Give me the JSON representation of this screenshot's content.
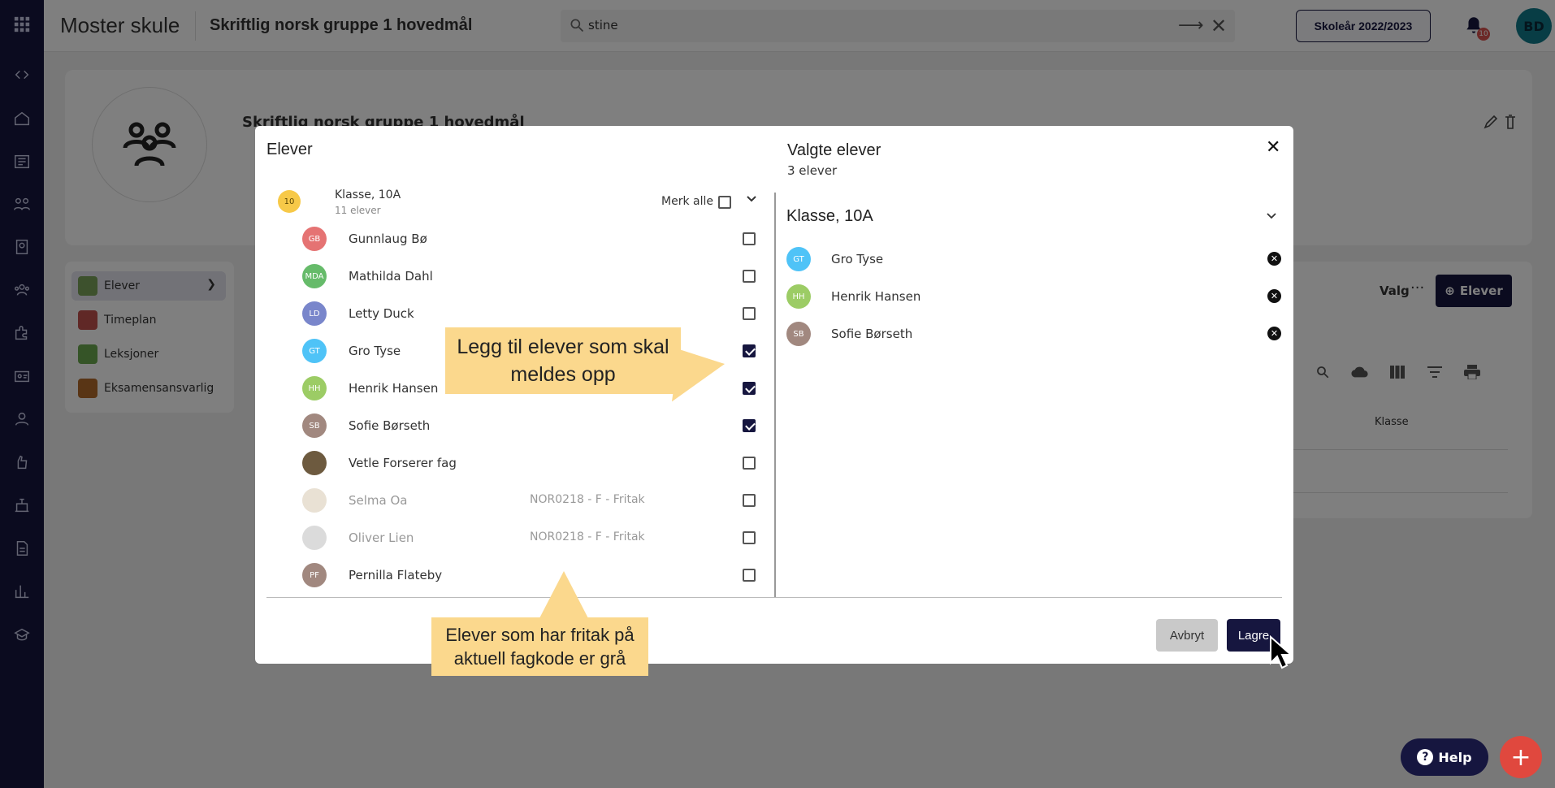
{
  "topbar": {
    "app_title": "Moster skule",
    "page_title": "Skriftlig norsk gruppe 1 hovedmål",
    "search_value": "stine",
    "school_year_button": "Skoleår 2022/2023",
    "notification_count": "10",
    "user_initials": "BD"
  },
  "rail_icons": [
    "apps-icon",
    "code-icon",
    "home-icon",
    "newspaper-icon",
    "groups-icon",
    "badge-icon",
    "people-icon",
    "puzzle-icon",
    "id-card-icon",
    "person-icon",
    "hand-icon",
    "building-icon",
    "document-icon",
    "bar-chart-icon",
    "school-icon"
  ],
  "background": {
    "card_title": "Skriftlig norsk gruppe 1 hovedmål",
    "side_menu": [
      {
        "label": "Elever",
        "icon": "students-icon"
      },
      {
        "label": "Timeplan",
        "icon": "clock-icon"
      },
      {
        "label": "Leksjoner",
        "icon": "grid-icon"
      },
      {
        "label": "Eksamensansvarlig",
        "icon": "teacher-icon"
      }
    ],
    "valg_label": "Valg",
    "elever_button": "Elever",
    "klasse_column": "Klasse"
  },
  "modal": {
    "title": "Elever",
    "class_group": {
      "avatar": "10",
      "name": "Klasse, 10A",
      "count": "11 elever"
    },
    "select_all_label": "Merk alle",
    "students": [
      {
        "initials": "GB",
        "name": "Gunnlaug Bø",
        "color": "#e57373",
        "checked": false,
        "exemption": "",
        "grey": false
      },
      {
        "initials": "MDA",
        "name": "Mathilda Dahl",
        "color": "#66bb6a",
        "checked": false,
        "exemption": "",
        "grey": false
      },
      {
        "initials": "LD",
        "name": "Letty Duck",
        "color": "#7986cb",
        "checked": false,
        "exemption": "",
        "grey": false
      },
      {
        "initials": "GT",
        "name": "Gro Tyse",
        "color": "#4fc3f7",
        "checked": true,
        "exemption": "",
        "grey": false
      },
      {
        "initials": "HH",
        "name": "Henrik Hansen",
        "color": "#9ccc65",
        "checked": true,
        "exemption": "",
        "grey": false
      },
      {
        "initials": "SB",
        "name": "Sofie Børseth",
        "color": "#a1887f",
        "checked": true,
        "exemption": "",
        "grey": false
      },
      {
        "initials": "",
        "name": "Vetle Forserer fag",
        "color": "#6d5a3f",
        "checked": false,
        "exemption": "",
        "grey": false
      },
      {
        "initials": "",
        "name": "Selma Oa",
        "color": "#d7c9b0",
        "checked": false,
        "exemption": "NOR0218 - F - Fritak",
        "grey": true
      },
      {
        "initials": "",
        "name": "Oliver Lien",
        "color": "#bdbdbd",
        "checked": false,
        "exemption": "NOR0218 - F - Fritak",
        "grey": true
      },
      {
        "initials": "PF",
        "name": "Pernilla Flateby",
        "color": "#a1887f",
        "checked": false,
        "exemption": "",
        "grey": false
      }
    ],
    "selected_title": "Valgte elever",
    "selected_count": "3 elever",
    "selected_class": "Klasse, 10A",
    "selected": [
      {
        "initials": "GT",
        "name": "Gro Tyse",
        "color": "#4fc3f7"
      },
      {
        "initials": "HH",
        "name": "Henrik Hansen",
        "color": "#9ccc65"
      },
      {
        "initials": "SB",
        "name": "Sofie Børseth",
        "color": "#a1887f"
      }
    ],
    "cancel_label": "Avbryt",
    "save_label": "Lagre"
  },
  "callouts": {
    "add": "Legg til elever som skal meldes opp",
    "exempt": "Elever som har fritak på aktuell fagkode er grå"
  },
  "help_label": "Help",
  "fab_label": "+"
}
